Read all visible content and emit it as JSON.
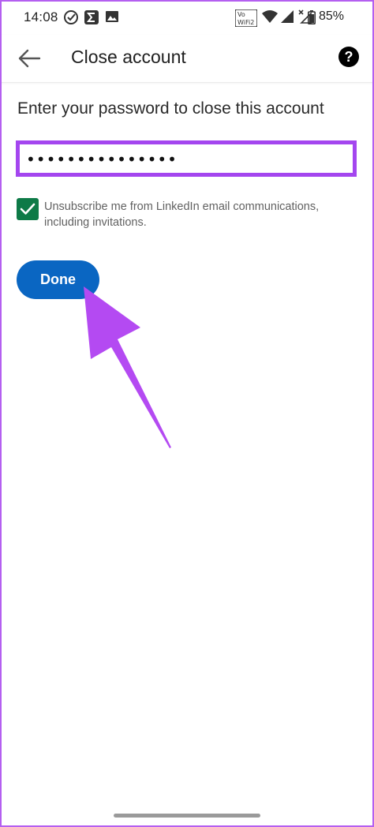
{
  "status_bar": {
    "time": "14:08",
    "battery": "85%",
    "icons": [
      "check-circle-icon",
      "sigma-icon",
      "image-icon",
      "volte-wifi-icon",
      "wifi-icon",
      "signal-icon",
      "signal-no-service-icon",
      "battery-icon"
    ]
  },
  "app_bar": {
    "title": "Close account",
    "back_icon": "back-arrow-icon",
    "help_icon": "help-icon",
    "help_glyph": "?"
  },
  "form": {
    "prompt": "Enter your password to close this account",
    "password_value": "•••••••••••••••",
    "checkbox_checked": true,
    "checkbox_label": "Unsubscribe me from LinkedIn email communications, including invitations."
  },
  "done_button": {
    "label": "Done"
  },
  "colors": {
    "primary_blue": "#0a66c2",
    "checkbox_green": "#0e7a47",
    "highlight_purple": "#a446ef"
  }
}
